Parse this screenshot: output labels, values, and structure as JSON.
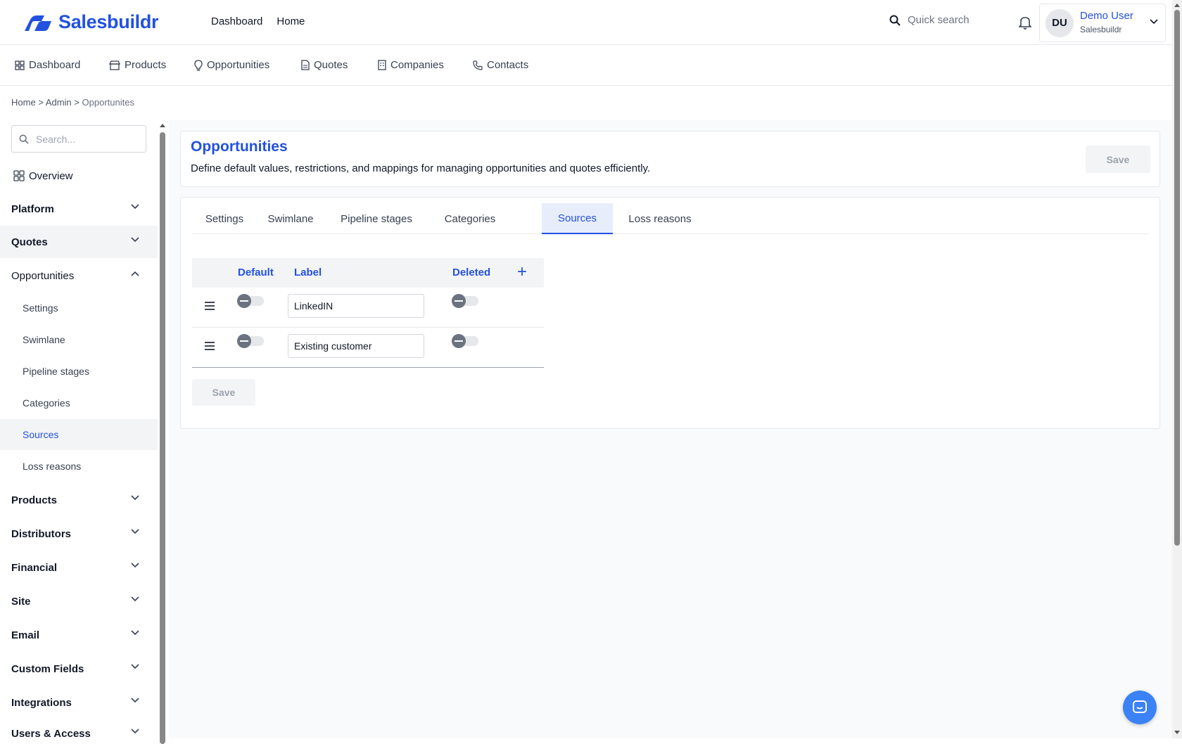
{
  "brand": {
    "name": "Salesbuildr"
  },
  "topnav": [
    "Dashboard",
    "Home"
  ],
  "search": {
    "placeholder": "Quick search"
  },
  "user": {
    "initials": "DU",
    "name": "Demo User",
    "org": "Salesbuildr"
  },
  "mainnav": [
    {
      "label": "Dashboard",
      "icon": "dashboard-icon"
    },
    {
      "label": "Products",
      "icon": "store-icon"
    },
    {
      "label": "Opportunities",
      "icon": "lightbulb-icon"
    },
    {
      "label": "Quotes",
      "icon": "document-icon"
    },
    {
      "label": "Companies",
      "icon": "building-icon"
    },
    {
      "label": "Contacts",
      "icon": "phone-icon"
    }
  ],
  "breadcrumb": {
    "home": "Home",
    "admin": "Admin",
    "current": "Opportunites",
    "sep": ">"
  },
  "sidebar": {
    "search_placeholder": "Search...",
    "overview": "Overview",
    "sections": {
      "platform": "Platform",
      "quotes": "Quotes",
      "opportunities": "Opportunities",
      "products": "Products",
      "distributors": "Distributors",
      "financial": "Financial",
      "site": "Site",
      "email": "Email",
      "custom_fields": "Custom Fields",
      "integrations": "Integrations",
      "users_access": "Users & Access"
    },
    "sub": {
      "settings": "Settings",
      "swimlane": "Swimlane",
      "pipeline": "Pipeline stages",
      "categories": "Categories",
      "sources": "Sources",
      "loss": "Loss reasons"
    }
  },
  "page": {
    "title": "Opportunities",
    "description": "Define default values, restrictions, and mappings for managing opportunities and quotes efficiently.",
    "save": "Save"
  },
  "tabs": {
    "settings": "Settings",
    "swimlane": "Swimlane",
    "pipeline": "Pipeline stages",
    "categories": "Categories",
    "sources": "Sources",
    "loss": "Loss reasons",
    "active": "Sources"
  },
  "table": {
    "headers": {
      "default": "Default",
      "label": "Label",
      "deleted": "Deleted"
    },
    "add": "+",
    "rows": [
      {
        "label": "LinkedIN",
        "default": false,
        "deleted": false
      },
      {
        "label": "Existing customer",
        "default": false,
        "deleted": false
      }
    ],
    "save": "Save"
  },
  "colors": {
    "accent": "#2251e0",
    "chat": "#3b82f6"
  }
}
